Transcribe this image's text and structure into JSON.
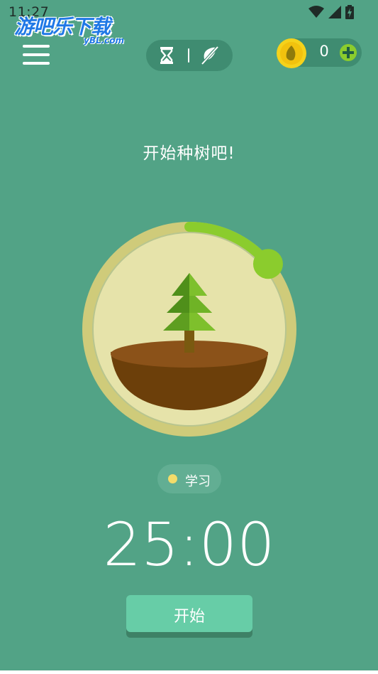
{
  "status_bar": {
    "time": "11:27",
    "icons": [
      "wifi-icon",
      "signal-icon",
      "battery-charging-icon"
    ]
  },
  "watermark": {
    "title": "游吧乐下载",
    "subtitle": "yBL.com"
  },
  "header": {
    "menu_icon": "hamburger-menu-icon",
    "mode_toggle": {
      "timer_icon": "hourglass-icon",
      "deep_focus_icon": "no-phone-icon"
    },
    "coins": {
      "icon": "gold-coin-seed-icon",
      "count": "0",
      "add_icon": "plus-circle-icon"
    }
  },
  "main": {
    "headline": "开始种树吧!",
    "tree": {
      "icon": "pine-tree-sapling-icon",
      "progress_fraction": 0.14
    },
    "tag": {
      "label": "学习",
      "color": "#f3dc6a"
    },
    "timer": "25:00",
    "start_button_label": "开始"
  },
  "colors": {
    "background": "#52a386",
    "accent": "#8bcc2d",
    "button": "#67cda7"
  }
}
